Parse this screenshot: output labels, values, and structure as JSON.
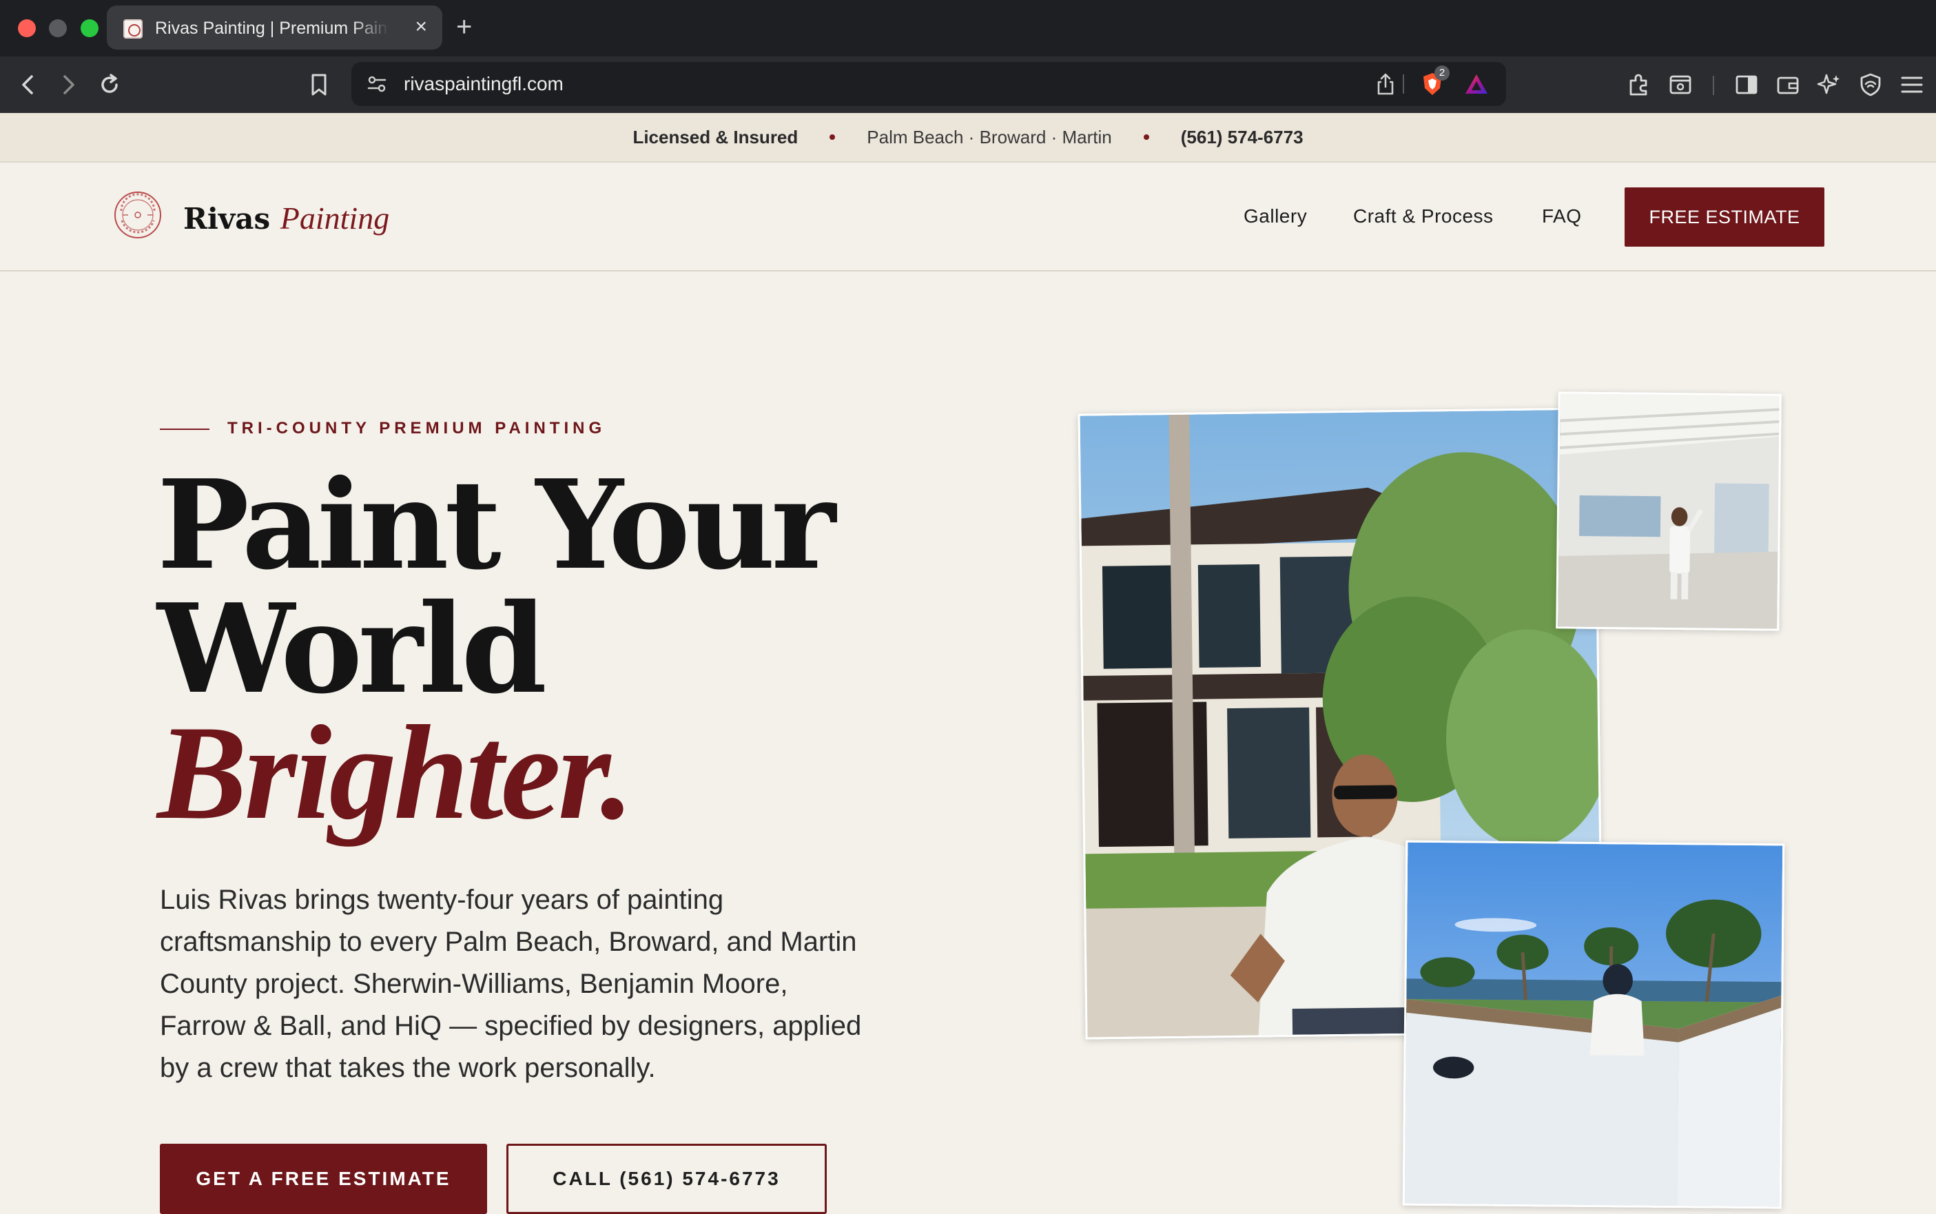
{
  "browser": {
    "tab_title": "Rivas Painting | Premium Painting",
    "tab_close": "×",
    "new_tab": "+",
    "url": "rivaspaintingfl.com",
    "extension_badge_count": "2"
  },
  "top_strip": {
    "licensed": "Licensed & Insured",
    "counties": "Palm Beach · Broward · Martin",
    "phone": "(561) 574-6773"
  },
  "nav": {
    "brand_name": "Rivas",
    "brand_accent": "Painting",
    "logo_ring_text": "PAINTING RIVAS SERVICES",
    "links": [
      "Gallery",
      "Craft & Process",
      "FAQ"
    ],
    "cta": "FREE ESTIMATE"
  },
  "hero": {
    "eyebrow": "TRI-COUNTY PREMIUM PAINTING",
    "headline_line1": "Paint Your",
    "headline_line2": "World",
    "headline_accent": "Brighter.",
    "lede": "Luis Rivas brings twenty-four years of painting craftsmanship to every Palm Beach, Broward, and Martin County project. Sherwin-Williams, Benjamin Moore, Farrow & Ball, and HiQ — specified by designers, applied by a crew that takes the work personally.",
    "primary_button": "GET A FREE ESTIMATE",
    "secondary_button": "CALL (561) 574-6773"
  },
  "colors": {
    "brand_burgundy": "#6e1619",
    "page_background": "#f4f1eb",
    "strip_background": "#ebe5da"
  }
}
